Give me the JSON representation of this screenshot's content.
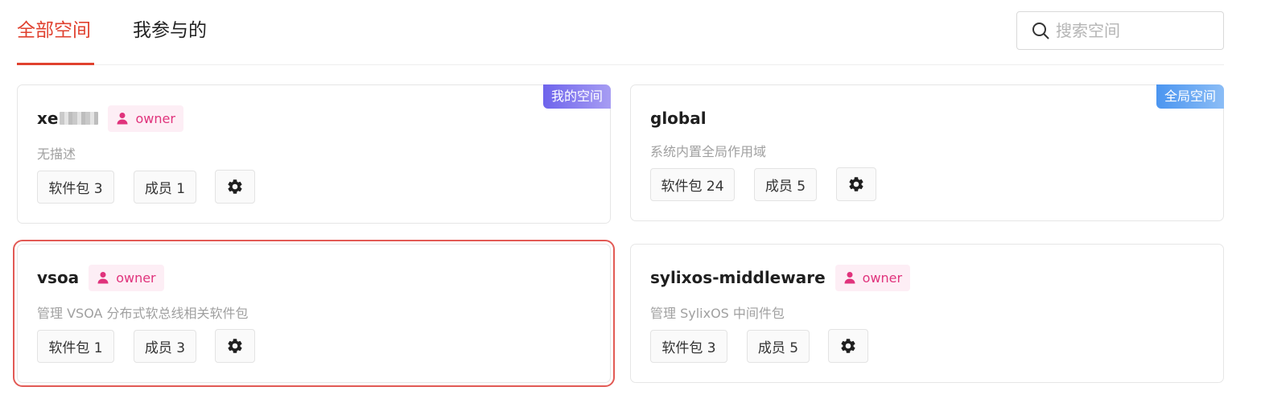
{
  "tabs": [
    {
      "label": "全部空间",
      "active": true
    },
    {
      "label": "我参与的",
      "active": false
    }
  ],
  "search": {
    "placeholder": "搜索空间",
    "icon": "search-icon"
  },
  "colors": {
    "accent": "#e0412f",
    "owner_text": "#e0337c",
    "owner_bg": "#fdeef5",
    "badge_mine": "#6e64ec",
    "badge_global": "#4b95f0",
    "selection": "#e25a55"
  },
  "cards": [
    {
      "name": "xe",
      "name_obscured": true,
      "role": "owner",
      "corner_badge": "我的空间",
      "description": "无描述",
      "packages_label": "软件包 3",
      "members_label": "成员 1",
      "settings_icon": "gear-icon"
    },
    {
      "name": "global",
      "corner_badge": "全局空间",
      "description": "系统内置全局作用域",
      "packages_label": "软件包 24",
      "members_label": "成员 5",
      "settings_icon": "gear-icon"
    },
    {
      "name": "vsoa",
      "role": "owner",
      "selected": true,
      "description": "管理 VSOA 分布式软总线相关软件包",
      "packages_label": "软件包 1",
      "members_label": "成员 3",
      "settings_icon": "gear-icon"
    },
    {
      "name": "sylixos-middleware",
      "role": "owner",
      "description": "管理 SylixOS 中间件包",
      "packages_label": "软件包 3",
      "members_label": "成员 5",
      "settings_icon": "gear-icon"
    }
  ]
}
